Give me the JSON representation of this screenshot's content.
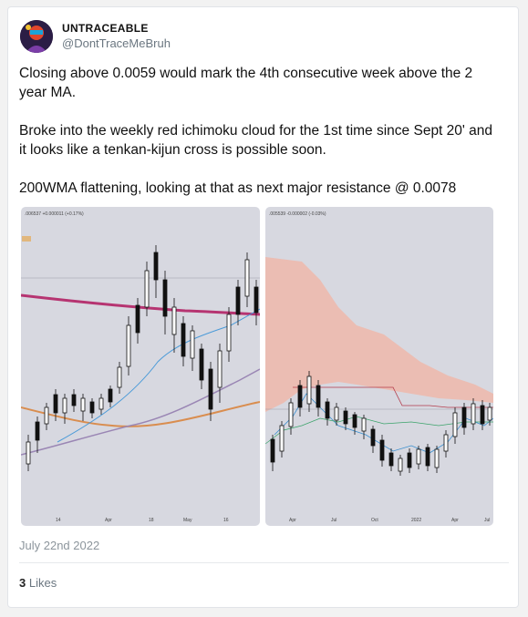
{
  "author": {
    "name": "UNTRACEABLE",
    "handle": "@DontTraceMeBruh",
    "avatar_icon": "avatar-image"
  },
  "tweet": {
    "paragraphs": [
      "Closing above 0.0059 would mark the 4th consecutive week above the 2 year MA.",
      "Broke into the weekly red ichimoku cloud for the 1st time since Sept 20' and it looks like a tenkan-kijun cross is possible soon.",
      "200WMA flattening, looking at that as next major resistance @ 0.0078"
    ],
    "date": "July 22nd 2022",
    "likes_count": "3",
    "likes_label": "Likes"
  },
  "images": {
    "left": {
      "header": ".006537 +0.000011 (+0.17%)",
      "x_labels": [
        "14",
        "Apr",
        "18",
        "May",
        "16"
      ]
    },
    "right": {
      "header": ".005539 -0.000002 (-0.03%)",
      "x_labels": [
        "Apr",
        "Jul",
        "Oct",
        "2022",
        "Apr",
        "Jul"
      ]
    }
  }
}
